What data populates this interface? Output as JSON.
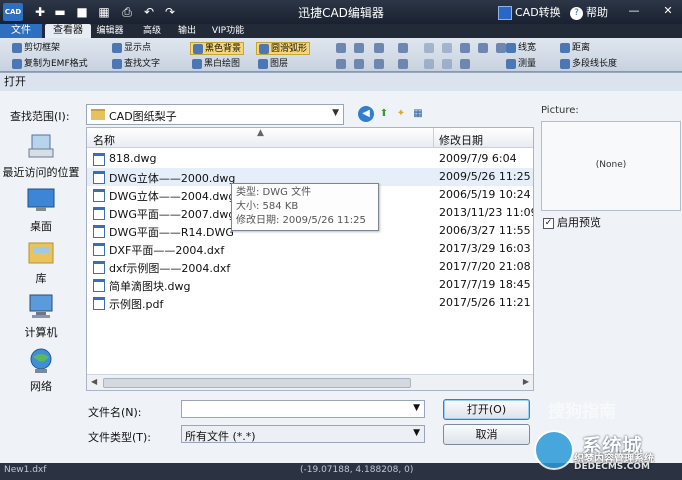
{
  "app": {
    "title": "迅捷CAD编辑器",
    "logo_text": "CAD",
    "convert_label": "CAD转换",
    "help_label": "帮助",
    "quick_access_icons": [
      "new-file-icon",
      "open-folder-icon",
      "save-icon",
      "grid-icon",
      "print-icon",
      "undo-icon",
      "redo-icon"
    ]
  },
  "menu": {
    "tabs": [
      "文件",
      "查看器",
      "编辑器",
      "高级",
      "输出",
      "VIP功能"
    ]
  },
  "ribbon": {
    "col1": [
      "剪切框架",
      "复制为EMF格式"
    ],
    "col2": [
      "显示点",
      "查找文字"
    ],
    "col3": [
      "黑色背景",
      "黑白绘图"
    ],
    "col4": [
      "圆滑弧形",
      "图层"
    ],
    "col5": [
      "线宽",
      "测量"
    ],
    "col6": [
      "距离",
      "多段线长度"
    ]
  },
  "dialog": {
    "title": "打开",
    "look_in_label": "查找范围(I):",
    "look_in_value": "CAD图纸梨子",
    "places": [
      "最近访问的位置",
      "桌面",
      "库",
      "计算机",
      "网络"
    ],
    "columns": {
      "name": "名称",
      "date": "修改日期"
    },
    "files": [
      {
        "name": "818.dwg",
        "date": "2009/7/9 6:04"
      },
      {
        "name": "DWG立体——2000.dwg",
        "date": "2009/5/26 11:25"
      },
      {
        "name": "DWG立体——2004.dwg",
        "date": "2006/5/19 10:24"
      },
      {
        "name": "DWG平面——2007.dwg",
        "date": "2013/11/23 11:09"
      },
      {
        "name": "DWG平面——R14.DWG",
        "date": "2006/3/27 11:55"
      },
      {
        "name": "DXF平面——2004.dxf",
        "date": "2017/3/29 16:03"
      },
      {
        "name": "dxf示例图——2004.dxf",
        "date": "2017/7/20 21:08"
      },
      {
        "name": "简单滴图块.dwg",
        "date": "2017/7/19 18:45"
      },
      {
        "name": "示例图.pdf",
        "date": "2017/5/26 11:21"
      }
    ],
    "tooltip": {
      "type": "类型: DWG 文件",
      "size": "大小: 584 KB",
      "modified": "修改日期: 2009/5/26 11:25"
    },
    "preview_label": "Picture:",
    "preview_none": "(None)",
    "enable_preview": "启用预览",
    "enable_preview_checked": "✓",
    "filename_label": "文件名(N):",
    "filename_value": "",
    "filetype_label": "文件类型(T):",
    "filetype_value": "所有文件 (*.*)",
    "open_button": "打开(O)",
    "cancel_button": "取消"
  },
  "statusbar": {
    "file": "New1.dxf",
    "coords": "(-19.07188, 4.188208, 0)"
  },
  "watermarks": {
    "sogou": "搜狗指南",
    "site_title": "系统城",
    "site_sub": "织梦内容管理系统",
    "site_url": "DEDECMS.COM"
  },
  "colors": {
    "accent": "#2e6fc0",
    "highlight": "#f5d77a",
    "folder": "#e8c15a"
  }
}
